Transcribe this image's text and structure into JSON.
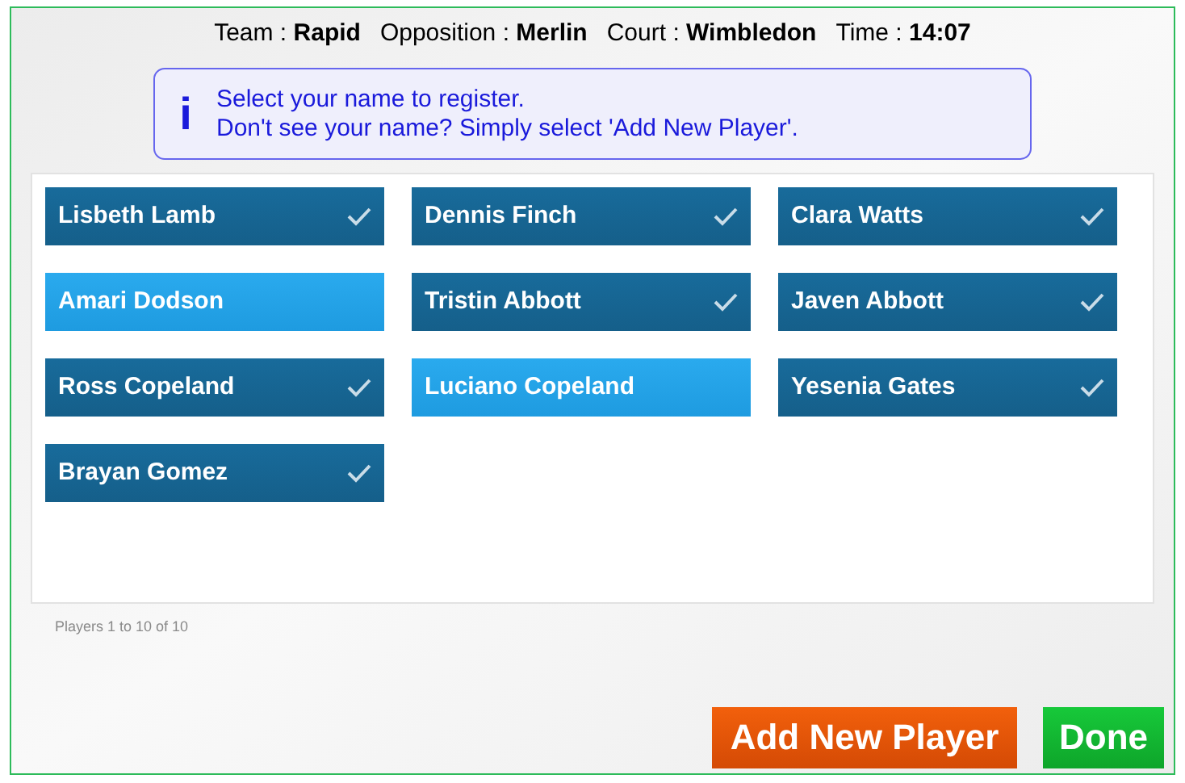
{
  "header": [
    {
      "label": "Team :",
      "value": "Rapid"
    },
    {
      "label": "Opposition :",
      "value": "Merlin"
    },
    {
      "label": "Court :",
      "value": "Wimbledon"
    },
    {
      "label": "Time :",
      "value": "14:07"
    }
  ],
  "info": {
    "icon": "i",
    "lines": [
      "Select your name to register.",
      "Don't see your name? Simply select 'Add New Player'."
    ]
  },
  "players": [
    {
      "name": "Lisbeth Lamb",
      "checked": true
    },
    {
      "name": "Dennis Finch",
      "checked": true
    },
    {
      "name": "Clara Watts",
      "checked": true
    },
    {
      "name": "Amari Dodson",
      "checked": false
    },
    {
      "name": "Tristin Abbott",
      "checked": true
    },
    {
      "name": "Javen Abbott",
      "checked": true
    },
    {
      "name": "Ross Copeland",
      "checked": true
    },
    {
      "name": "Luciano Copeland",
      "checked": false
    },
    {
      "name": "Yesenia Gates",
      "checked": true
    },
    {
      "name": "Brayan Gomez",
      "checked": true
    }
  ],
  "pager": "Players 1 to 10 of 10",
  "buttons": [
    {
      "label": "Add New Player",
      "kind": "add"
    },
    {
      "label": "Done",
      "kind": "done"
    }
  ]
}
